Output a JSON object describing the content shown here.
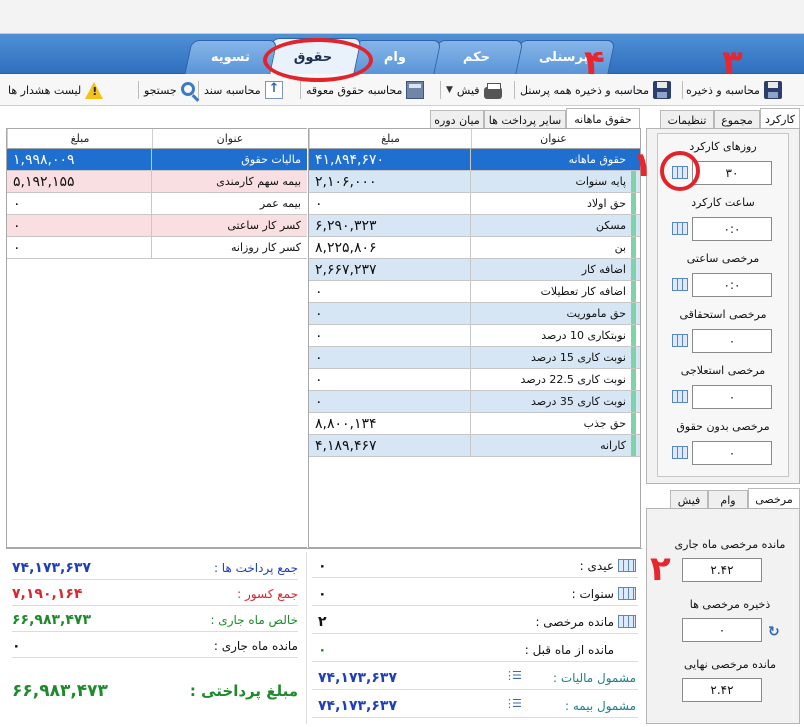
{
  "main_tabs": [
    {
      "id": "personnel",
      "label": "پرسنلی"
    },
    {
      "id": "order",
      "label": "حکم"
    },
    {
      "id": "loan",
      "label": "وام"
    },
    {
      "id": "salary",
      "label": "حقوق"
    },
    {
      "id": "settlement",
      "label": "تسویه"
    }
  ],
  "toolbar": {
    "calc_save": "محاسبه و ذخیره",
    "calc_save_all": "محاسبه و ذخیره همه پرسنل",
    "slip": "فیش",
    "calc_pending": "محاسبه حقوق معوقه",
    "calc_doc": "محاسبه سند",
    "search": "جستجو",
    "alert_list": "لیست هشدار ها"
  },
  "center_tabs": {
    "monthly": "حقوق ماهانه",
    "other_payments": "سایر پرداخت ها",
    "mid_period": "میان دوره"
  },
  "grid_headers": {
    "title": "عنوان",
    "amount": "مبلغ"
  },
  "monthly_rows": [
    {
      "title": "حقوق ماهانه",
      "amount": "۴۱,۸۹۴,۶۷۰",
      "style": "sel"
    },
    {
      "title": "پایه سنوات",
      "amount": "۲,۱۰۶,۰۰۰",
      "style": "blue"
    },
    {
      "title": "حق اولاد",
      "amount": "۰",
      "style": "white"
    },
    {
      "title": "مسکن",
      "amount": "۶,۲۹۰,۳۲۳",
      "style": "blue"
    },
    {
      "title": "بن",
      "amount": "۸,۲۲۵,۸۰۶",
      "style": "white"
    },
    {
      "title": "اضافه کار",
      "amount": "۲,۶۶۷,۲۳۷",
      "style": "blue"
    },
    {
      "title": "اضافه کار تعطیلات",
      "amount": "۰",
      "style": "white"
    },
    {
      "title": "حق ماموریت",
      "amount": "۰",
      "style": "blue"
    },
    {
      "title": "نوبتکاری 10 درصد",
      "amount": "۰",
      "style": "white"
    },
    {
      "title": "نوبت کاری 15 درصد",
      "amount": "۰",
      "style": "blue"
    },
    {
      "title": "نوبت کاری 22.5 درصد",
      "amount": "۰",
      "style": "white"
    },
    {
      "title": "نوبت کاری 35 درصد",
      "amount": "۰",
      "style": "blue"
    },
    {
      "title": "حق جذب",
      "amount": "۸,۸۰۰,۱۳۴",
      "style": "white"
    },
    {
      "title": "کارانه",
      "amount": "۴,۱۸۹,۴۶۷",
      "style": "blue"
    }
  ],
  "deduction_rows": [
    {
      "title": "مالیات حقوق",
      "amount": "۱,۹۹۸,۰۰۹",
      "style": "sel"
    },
    {
      "title": "بیمه سهم کارمندی",
      "amount": "۵,۱۹۲,۱۵۵",
      "style": "pink"
    },
    {
      "title": "بیمه عمر",
      "amount": "۰",
      "style": "white"
    },
    {
      "title": "کسر کار ساعتی",
      "amount": "۰",
      "style": "pink"
    },
    {
      "title": "کسر کار روزانه",
      "amount": "۰",
      "style": "white"
    }
  ],
  "right_tabs": {
    "work": "کارکرد",
    "total": "مجموع",
    "settings": "تنظیمات"
  },
  "work_fields": [
    {
      "label": "روزهای کارکرد",
      "value": "۳۰"
    },
    {
      "label": "ساعت کارکرد",
      "value": "۰:۰"
    },
    {
      "label": "مرخصی ساعتی",
      "value": "۰:۰"
    },
    {
      "label": "مرخصی استحقاقی",
      "value": "۰"
    },
    {
      "label": "مرخصی استعلاجی",
      "value": "۰"
    },
    {
      "label": "مرخصی بدون حقوق",
      "value": "۰"
    }
  ],
  "leave_tabs": {
    "leave": "مرخصی",
    "loan": "وام",
    "slip": "فیش"
  },
  "leave_fields": [
    {
      "label": "مانده مرخصی ماه جاری",
      "value": "۲.۴۲"
    },
    {
      "label": "ذخیره مرخصی ها",
      "value": "۰"
    },
    {
      "label": "مانده مرخصی نهایی",
      "value": "۲.۴۲"
    }
  ],
  "center_summary": [
    {
      "label": "عیدی :",
      "value": "۰"
    },
    {
      "label": "سنوات :",
      "value": "۰"
    },
    {
      "label": "مانده مرخصی :",
      "value": "۲"
    },
    {
      "label": "مانده از ماه قبل :",
      "value": "۰"
    },
    {
      "label": "مشمول مالیات :",
      "value": "۷۴,۱۷۳,۶۳۷"
    },
    {
      "label": "مشمول بیمه :",
      "value": "۷۴,۱۷۳,۶۳۷"
    }
  ],
  "left_summary": [
    {
      "label": "جمع پرداخت ها :",
      "value": "۷۴,۱۷۳,۶۳۷"
    },
    {
      "label": "جمع کسور :",
      "value": "۷,۱۹۰,۱۶۴"
    },
    {
      "label": "خالص ماه جاری :",
      "value": "۶۶,۹۸۳,۴۷۳"
    },
    {
      "label": "مانده ماه جاری :",
      "value": "۰"
    },
    {
      "label": "مبلغ پرداختی :",
      "value": "۶۶,۹۸۳,۴۷۳"
    }
  ],
  "annotations": [
    "۱",
    "۲",
    "۳",
    "۴"
  ],
  "colors": {
    "select_blue": "#1f6fd0",
    "row_blue": "#d7e6f4",
    "row_pink": "#f9dfe1",
    "sum_blue": "#1f3fb8",
    "sum_red": "#d8262e",
    "sum_green": "#1e8a2c",
    "accent_red": "#e3232c"
  }
}
